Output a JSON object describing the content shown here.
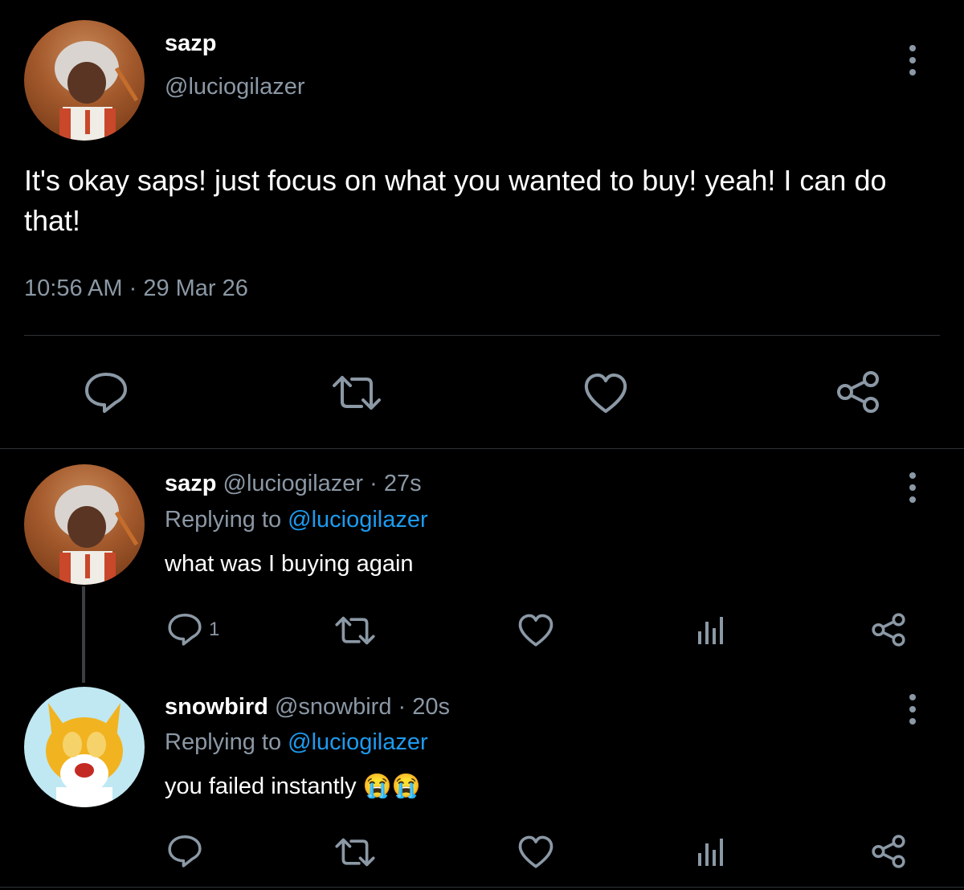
{
  "main_tweet": {
    "display_name": "sazp",
    "handle": "@luciogilazer",
    "text": "It's okay saps! just focus on what you wanted to buy! yeah! I can do that!",
    "time": "10:56 AM",
    "separator": "·",
    "date": "29 Mar 26"
  },
  "replies": [
    {
      "display_name": "sazp",
      "handle": "@luciogilazer",
      "age": "· 27s",
      "replying_label": "Replying to",
      "replying_to": "@luciogilazer",
      "text": "what was I buying again",
      "reply_count": "1"
    },
    {
      "display_name": "snowbird",
      "handle": "@snowbird",
      "age": "· 20s",
      "replying_label": "Replying to",
      "replying_to": "@luciogilazer",
      "text": "you failed instantly",
      "emoji": "😭😭"
    }
  ],
  "icons": [
    "reply-icon",
    "retweet-icon",
    "like-icon",
    "share-icon",
    "analytics-icon",
    "more-icon"
  ],
  "colors": {
    "background": "#000000",
    "muted": "#8b98a5",
    "link": "#1d9bf0",
    "divider": "#2f3336"
  }
}
